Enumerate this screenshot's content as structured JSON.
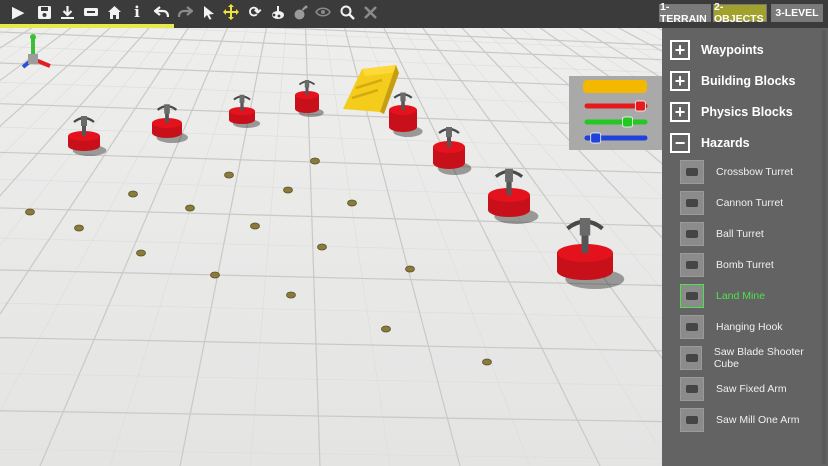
{
  "toolbar": {
    "icons": [
      "play-icon",
      "save-icon",
      "download-icon",
      "minus-box-icon",
      "home-icon",
      "info-icon",
      "undo-icon",
      "redo-icon",
      "pointer-icon",
      "move-icon",
      "refresh-icon",
      "paint-icon",
      "bomb-icon",
      "eye-icon",
      "search-icon",
      "close-icon"
    ],
    "progress_percent": 21
  },
  "mode_tabs": [
    {
      "label": "1-TERRAIN",
      "active": false
    },
    {
      "label": "2-OBJECTS",
      "active": true
    },
    {
      "label": "3-LEVEL",
      "active": false
    }
  ],
  "color_panel": {
    "swatch_color": "#f5b800",
    "sliders": [
      {
        "color": "#e51b1b",
        "value": 0.92
      },
      {
        "color": "#23c823",
        "value": 0.7
      },
      {
        "color": "#2042d8",
        "value": 0.15
      }
    ]
  },
  "sidebar": {
    "categories": [
      {
        "label": "Waypoints",
        "state": "+"
      },
      {
        "label": "Building Blocks",
        "state": "+"
      },
      {
        "label": "Physics Blocks",
        "state": "+"
      },
      {
        "label": "Hazards",
        "state": "−"
      }
    ],
    "items": [
      {
        "label": "Crossbow Turret",
        "selected": false
      },
      {
        "label": "Cannon Turret",
        "selected": false
      },
      {
        "label": "Ball Turret",
        "selected": false
      },
      {
        "label": "Bomb Turret",
        "selected": false
      },
      {
        "label": "Land Mine",
        "selected": true
      },
      {
        "label": "Hanging Hook",
        "selected": false
      },
      {
        "label": "Saw Blade Shooter Cube",
        "selected": false
      },
      {
        "label": "Saw Fixed Arm",
        "selected": false
      },
      {
        "label": "Saw Mill One Arm",
        "selected": false
      }
    ]
  },
  "colors": {
    "turret_red": "#e3121d",
    "ramp_yellow": "#f3c81a",
    "mine": "#8a7a3b",
    "selected_green": "#4ee14e"
  }
}
